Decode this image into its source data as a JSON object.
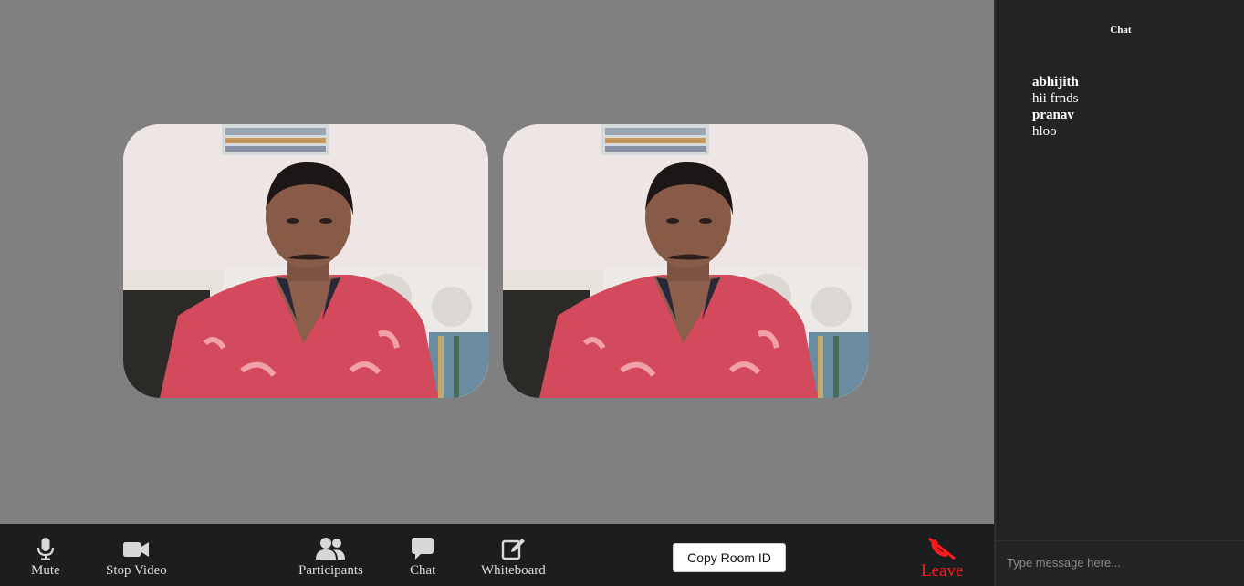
{
  "toolbar": {
    "mute_label": "Mute",
    "stop_video_label": "Stop Video",
    "participants_label": "Participants",
    "chat_label": "Chat",
    "whiteboard_label": "Whiteboard",
    "copy_room_id_label": "Copy Room ID",
    "leave_label": "Leave",
    "leave_color": "#ff1a1a"
  },
  "videos": [
    {
      "name": "participant-video-1"
    },
    {
      "name": "participant-video-2"
    }
  ],
  "chat": {
    "title": "Chat",
    "messages": [
      {
        "sender": "abhijith",
        "text": "hii frnds"
      },
      {
        "sender": "pranav",
        "text": "hloo"
      }
    ],
    "input_placeholder": "Type message here..."
  },
  "icons": [
    "microphone-icon",
    "video-camera-icon",
    "participants-icon",
    "chat-bubble-icon",
    "whiteboard-edit-icon",
    "phone-leave-icon"
  ]
}
